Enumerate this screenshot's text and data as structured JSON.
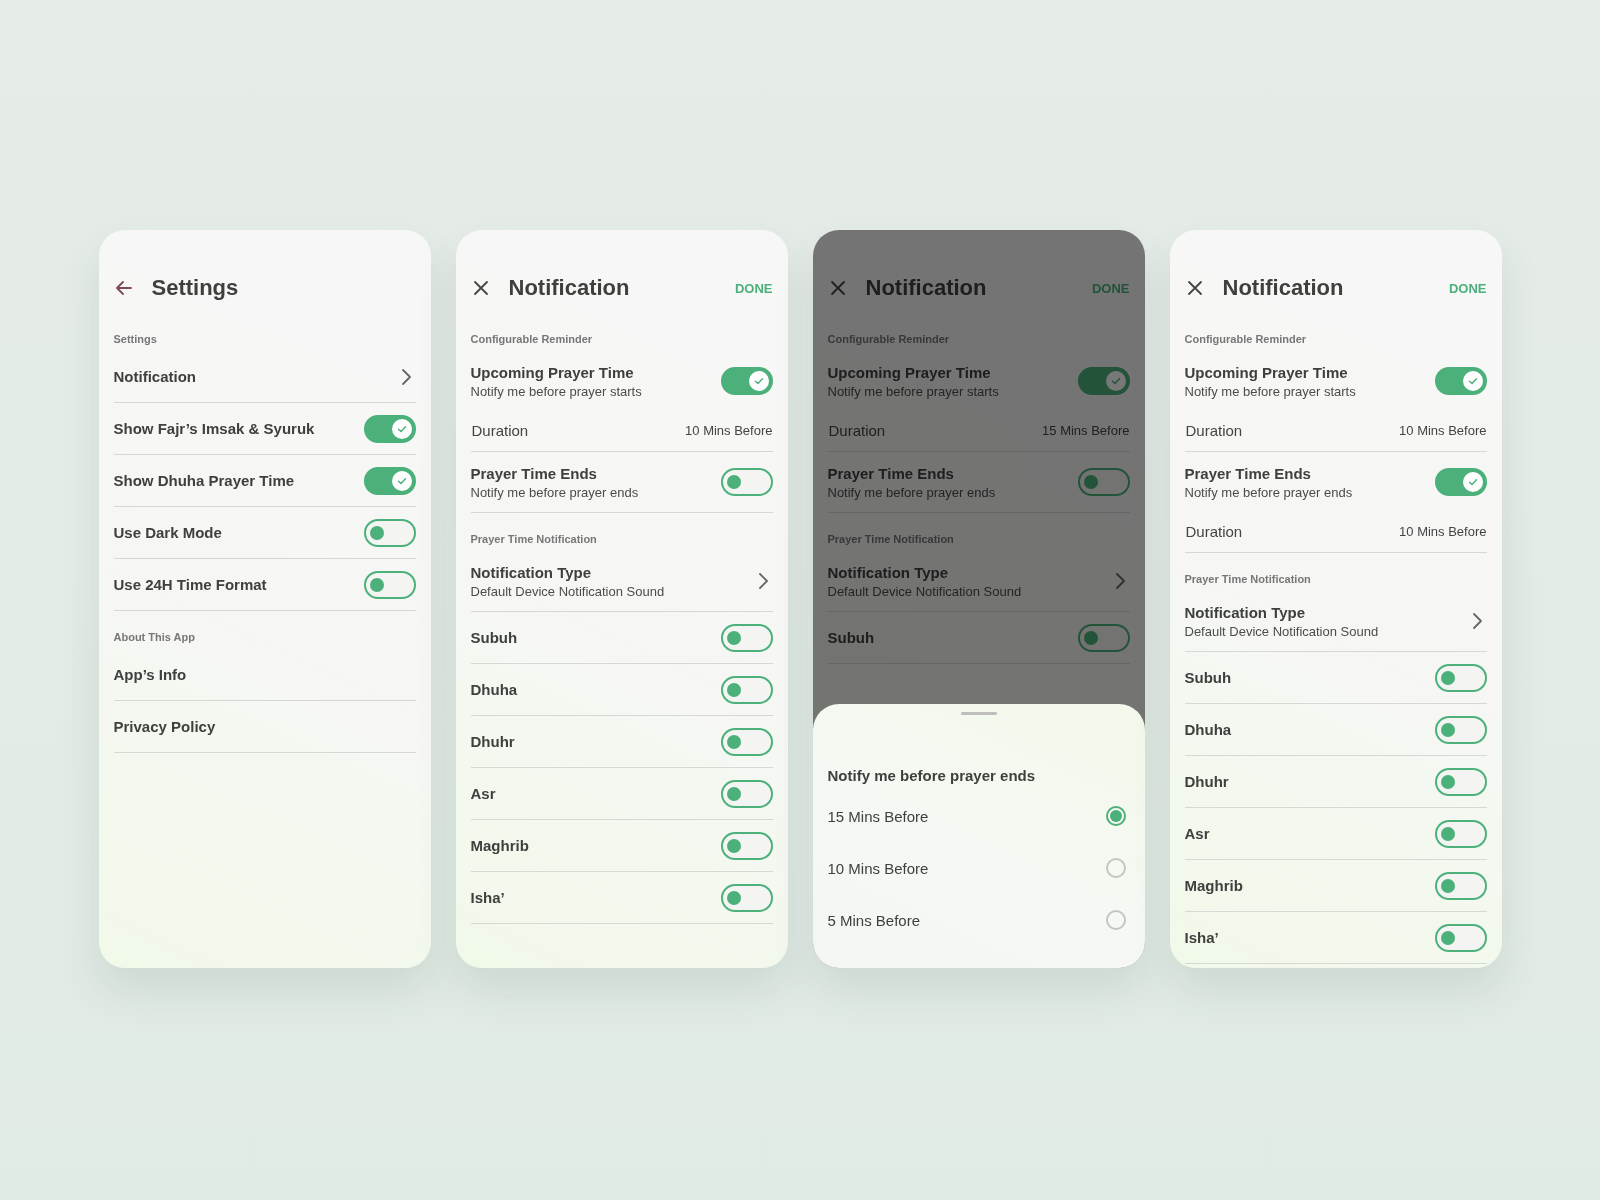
{
  "screens": [
    {
      "kind": "main",
      "title": "Settings",
      "dimmed": false,
      "sections": [
        {
          "heading": "Settings",
          "rows": [
            {
              "kind": "link",
              "label": "Notification"
            },
            {
              "kind": "switch",
              "label": "Show Fajr’s Imsak & Syuruk",
              "on": true
            },
            {
              "kind": "switch",
              "label": "Show Dhuha Prayer Time",
              "on": true
            },
            {
              "kind": "switch",
              "label": "Use Dark Mode",
              "on": false
            },
            {
              "kind": "switch",
              "label": "Use 24H Time Format",
              "on": false
            }
          ]
        },
        {
          "heading": "About This App",
          "rows": [
            {
              "kind": "text",
              "label": "App’s Info"
            },
            {
              "kind": "text",
              "label": "Privacy Policy"
            }
          ]
        }
      ]
    },
    {
      "kind": "modal",
      "title": "Notification",
      "action": "DONE",
      "dimmed": false,
      "sections": [
        {
          "heading": "Configurable Reminder",
          "rows": [
            {
              "kind": "switch",
              "label": "Upcoming Prayer Time",
              "sublabel": "Notify me before prayer starts",
              "on": true,
              "detail": {
                "label": "Duration",
                "value": "10 Mins Before"
              }
            },
            {
              "kind": "switch",
              "label": "Prayer Time Ends",
              "sublabel": "Notify me before prayer ends",
              "on": false
            }
          ]
        },
        {
          "heading": "Prayer Time Notification",
          "rows": [
            {
              "kind": "link",
              "label": "Notification Type",
              "sublabel": "Default Device Notification Sound"
            },
            {
              "kind": "switch",
              "label": "Subuh",
              "on": false
            },
            {
              "kind": "switch",
              "label": "Dhuha",
              "on": false
            },
            {
              "kind": "switch",
              "label": "Dhuhr",
              "on": false
            },
            {
              "kind": "switch",
              "label": "Asr",
              "on": false
            },
            {
              "kind": "switch",
              "label": "Maghrib",
              "on": false
            },
            {
              "kind": "switch",
              "label": "Isha’",
              "on": false
            }
          ]
        }
      ]
    },
    {
      "kind": "modal",
      "title": "Notification",
      "action": "DONE",
      "dimmed": true,
      "sections": [
        {
          "heading": "Configurable Reminder",
          "rows": [
            {
              "kind": "switch",
              "label": "Upcoming Prayer Time",
              "sublabel": "Notify me before prayer starts",
              "on": true,
              "detail": {
                "label": "Duration",
                "value": "15 Mins Before"
              }
            },
            {
              "kind": "switch",
              "label": "Prayer Time Ends",
              "sublabel": "Notify me before prayer ends",
              "on": false
            }
          ]
        },
        {
          "heading": "Prayer Time Notification",
          "rows": [
            {
              "kind": "link",
              "label": "Notification Type",
              "sublabel": "Default Device Notification Sound"
            },
            {
              "kind": "switch",
              "label": "Subuh",
              "on": false
            }
          ]
        }
      ],
      "sheet": {
        "title": "Notify me before prayer ends",
        "options": [
          {
            "label": "15 Mins Before",
            "selected": true
          },
          {
            "label": "10 Mins Before",
            "selected": false
          },
          {
            "label": "5 Mins Before",
            "selected": false
          }
        ]
      }
    },
    {
      "kind": "modal",
      "title": "Notification",
      "action": "DONE",
      "dimmed": false,
      "sections": [
        {
          "heading": "Configurable Reminder",
          "rows": [
            {
              "kind": "switch",
              "label": "Upcoming Prayer Time",
              "sublabel": "Notify me before prayer starts",
              "on": true,
              "detail": {
                "label": "Duration",
                "value": "10 Mins Before"
              }
            },
            {
              "kind": "switch",
              "label": "Prayer Time Ends",
              "sublabel": "Notify me before prayer ends",
              "on": true,
              "detail": {
                "label": "Duration",
                "value": "10 Mins Before"
              }
            }
          ]
        },
        {
          "heading": "Prayer Time Notification",
          "rows": [
            {
              "kind": "link",
              "label": "Notification Type",
              "sublabel": "Default Device Notification Sound"
            },
            {
              "kind": "switch",
              "label": "Subuh",
              "on": false
            },
            {
              "kind": "switch",
              "label": "Dhuha",
              "on": false
            },
            {
              "kind": "switch",
              "label": "Dhuhr",
              "on": false
            },
            {
              "kind": "switch",
              "label": "Asr",
              "on": false
            },
            {
              "kind": "switch",
              "label": "Maghrib",
              "on": false
            },
            {
              "kind": "switch",
              "label": "Isha’",
              "on": false
            }
          ]
        }
      ]
    }
  ]
}
